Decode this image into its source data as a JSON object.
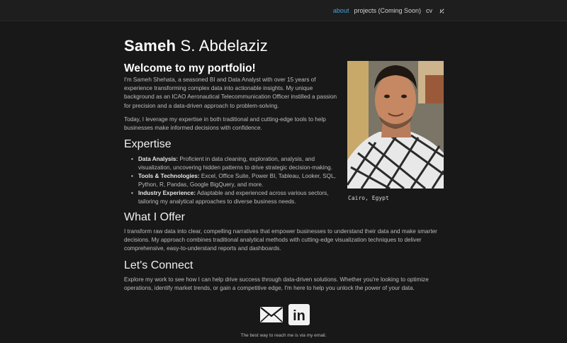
{
  "nav": {
    "items": [
      {
        "label": "about",
        "active": true
      },
      {
        "label": "projects (Coming Soon)",
        "active": false
      },
      {
        "label": "cv",
        "active": false
      }
    ],
    "theme_icon": "theme-toggle-icon"
  },
  "header": {
    "first_name": "Sameh",
    "last_name": "S. Abdelaziz"
  },
  "welcome": "Welcome to my portfolio!",
  "intro": {
    "p1": "I'm Sameh Shehata, a seasoned BI and Data Analyst with over 15 years of experience transforming complex data into actionable insights. My unique background as an ICAO Aeronautical Telecommunication Officer instilled a passion for precision and a data-driven approach to problem-solving.",
    "p2": "Today, I leverage my expertise in both traditional and cutting-edge tools to help businesses make informed decisions with confidence."
  },
  "expertise": {
    "title": "Expertise",
    "items": [
      {
        "label": "Data Analysis:",
        "text": " Proficient in data cleaning, exploration, analysis, and visualization, uncovering hidden patterns to drive strategic decision-making."
      },
      {
        "label": "Tools & Technologies:",
        "text": " Excel, Office Suite, Power BI, Tableau, Looker, SQL, Python, R, Pandas, Google BigQuery, and more."
      },
      {
        "label": "Industry Experience:",
        "text": " Adaptable and experienced across various sectors, tailoring my analytical approaches to diverse business needs."
      }
    ]
  },
  "offer": {
    "title": "What I Offer",
    "text": "I transform raw data into clear, compelling narratives that empower businesses to understand their data and make smarter decisions. My approach combines traditional analytical methods with cutting-edge visualization techniques to deliver comprehensive, easy-to-understand reports and dashboards."
  },
  "connect": {
    "title": "Let's Connect",
    "text": "Explore my work to see how I can help drive success through data-driven solutions. Whether you're looking to optimize operations, identify market trends, or gain a competitive edge, I'm here to help you unlock the power of your data."
  },
  "photo": {
    "caption": "Cairo, Egypt"
  },
  "social": {
    "email_icon": "envelope-icon",
    "linkedin_icon": "linkedin-icon",
    "linkedin_text": "in"
  },
  "footer": {
    "note": "The best way to reach me is via my email."
  }
}
